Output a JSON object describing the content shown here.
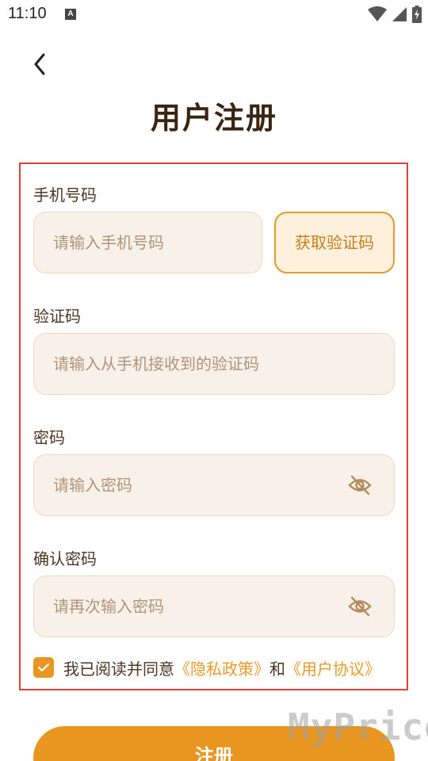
{
  "status_bar": {
    "time": "11:10",
    "badge_letter": "A"
  },
  "page_title": "用户注册",
  "phone": {
    "label": "手机号码",
    "placeholder": "请输入手机号码",
    "get_code_label": "获取验证码"
  },
  "code": {
    "label": "验证码",
    "placeholder": "请输入从手机接收到的验证码"
  },
  "password": {
    "label": "密码",
    "placeholder": "请输入密码"
  },
  "confirm_password": {
    "label": "确认密码",
    "placeholder": "请再次输入密码"
  },
  "agreement": {
    "checked": true,
    "prefix": "我已阅读并同意",
    "privacy_link": "《隐私政策》",
    "conjunction": "和",
    "user_agreement_link": "《用户协议》"
  },
  "register_label": "注册",
  "watermark": "MyPrice",
  "colors": {
    "accent": "#e8961f",
    "input_bg": "#f7f1ea",
    "highlight_border": "#e0403a"
  }
}
